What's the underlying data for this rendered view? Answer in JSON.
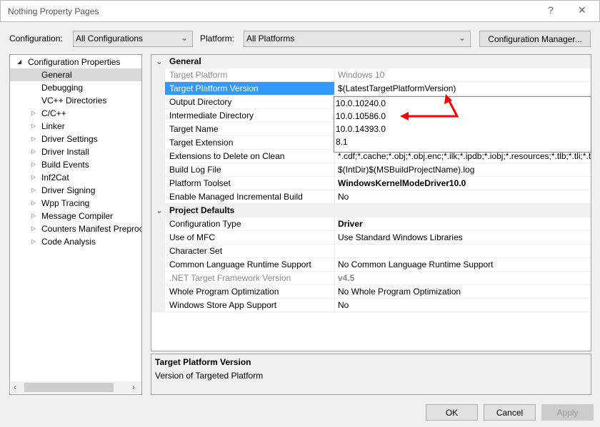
{
  "window": {
    "title": "Nothing Property Pages",
    "help": "?",
    "close": "✕"
  },
  "toolbar": {
    "configuration_label": "Configuration:",
    "configuration_value": "All Configurations",
    "platform_label": "Platform:",
    "platform_value": "All Platforms",
    "config_manager": "Configuration Manager..."
  },
  "tree": {
    "root": "Configuration Properties",
    "items": [
      {
        "label": "General",
        "expandable": false,
        "selected": true
      },
      {
        "label": "Debugging",
        "expandable": false
      },
      {
        "label": "VC++ Directories",
        "expandable": false
      },
      {
        "label": "C/C++",
        "expandable": true
      },
      {
        "label": "Linker",
        "expandable": true
      },
      {
        "label": "Driver Settings",
        "expandable": true
      },
      {
        "label": "Driver Install",
        "expandable": true
      },
      {
        "label": "Build Events",
        "expandable": true
      },
      {
        "label": "Inf2Cat",
        "expandable": true
      },
      {
        "label": "Driver Signing",
        "expandable": true
      },
      {
        "label": "Wpp Tracing",
        "expandable": true
      },
      {
        "label": "Message Compiler",
        "expandable": true
      },
      {
        "label": "Counters Manifest Preproc",
        "expandable": true
      },
      {
        "label": "Code Analysis",
        "expandable": true
      }
    ]
  },
  "grid": {
    "rows": [
      {
        "type": "cat",
        "label": "General"
      },
      {
        "label": "Target Platform",
        "value": "Windows 10",
        "style": "grey"
      },
      {
        "label": "Target Platform Version",
        "value": "$(LatestTargetPlatformVersion)",
        "selected": true
      },
      {
        "label": "Output Directory",
        "value": ""
      },
      {
        "label": "Intermediate Directory",
        "value": ""
      },
      {
        "label": "Target Name",
        "value": ""
      },
      {
        "label": "Target Extension",
        "value": ""
      },
      {
        "label": "Extensions to Delete on Clean",
        "value": "*.cdf;*.cache;*.obj;*.obj.enc;*.ilk;*.ipdb;*.iobj;*.resources;*.tlb;*.tli;*.t"
      },
      {
        "label": "Build Log File",
        "value": "$(IntDir)$(MSBuildProjectName).log"
      },
      {
        "label": "Platform Toolset",
        "value": "WindowsKernelModeDriver10.0",
        "style": "bold"
      },
      {
        "label": "Enable Managed Incremental Build",
        "value": "No"
      },
      {
        "type": "cat",
        "label": "Project Defaults"
      },
      {
        "label": "Configuration Type",
        "value": "Driver",
        "style": "bold"
      },
      {
        "label": "Use of MFC",
        "value": "Use Standard Windows Libraries"
      },
      {
        "label": "Character Set",
        "value": ""
      },
      {
        "label": "Common Language Runtime Support",
        "value": "No Common Language Runtime Support"
      },
      {
        "label": ".NET Target Framework Version",
        "value": "v4.5",
        "style": "greybold"
      },
      {
        "label": "Whole Program Optimization",
        "value": "No Whole Program Optimization"
      },
      {
        "label": "Windows Store App Support",
        "value": "No"
      }
    ]
  },
  "dropdown": {
    "options": [
      "10.0.10240.0",
      "10.0.10586.0",
      "10.0.14393.0",
      "8.1"
    ]
  },
  "description": {
    "title": "Target Platform Version",
    "text": "Version of Targeted Platform"
  },
  "buttons": {
    "ok": "OK",
    "cancel": "Cancel",
    "apply": "Apply"
  },
  "colors": {
    "selection": "#3399ff",
    "annotation_arrow": "#ff0000"
  }
}
